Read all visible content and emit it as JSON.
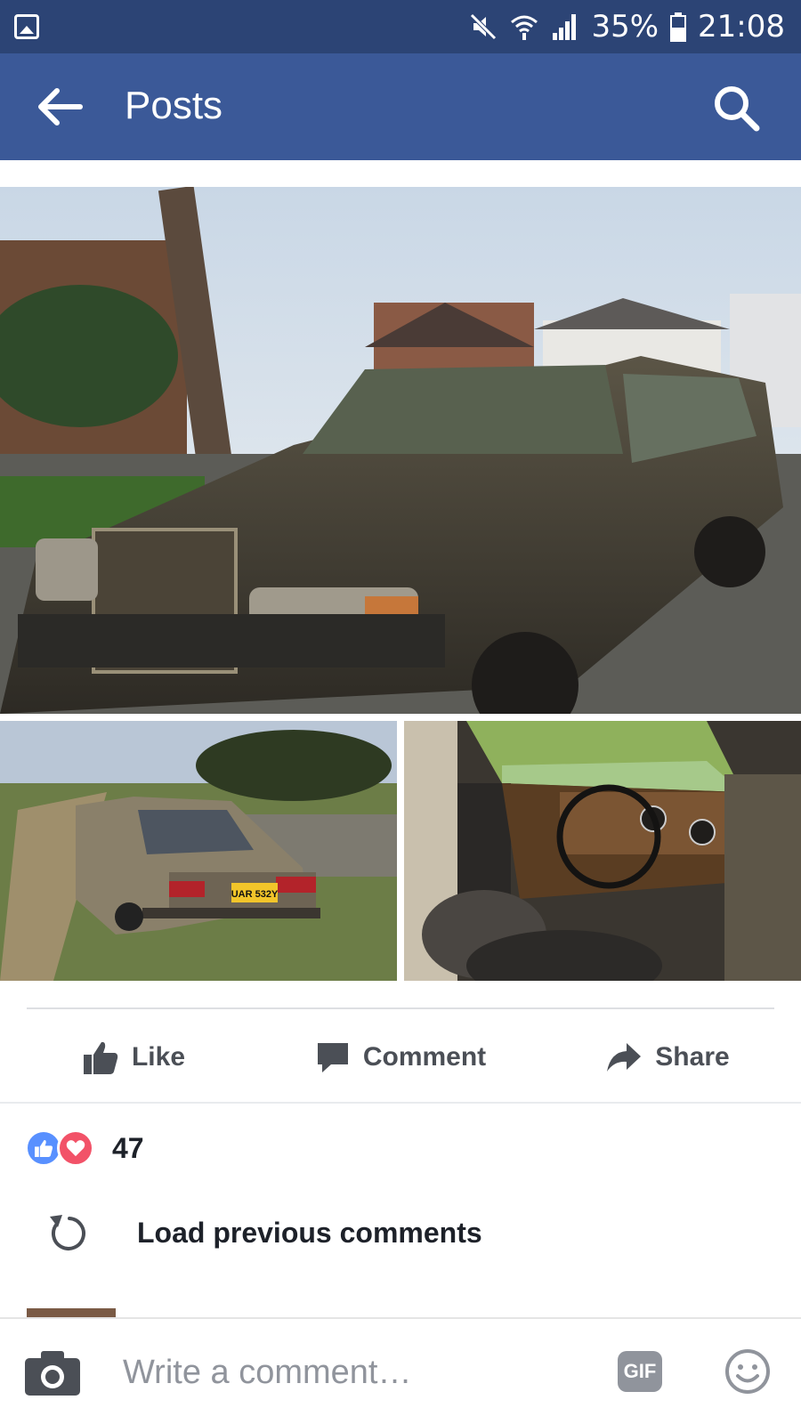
{
  "status_bar": {
    "battery": "35%",
    "time": "21:08"
  },
  "app_bar": {
    "title": "Posts"
  },
  "post": {
    "photos": [
      {
        "alt": "Rolls-Royce sedan parked on a residential street"
      },
      {
        "alt": "Rear view of the car on a countryside track",
        "plate": "UAR 532Y"
      },
      {
        "alt": "Interior with wooden dashboard and steering wheel"
      }
    ],
    "actions": {
      "like": "Like",
      "comment": "Comment",
      "share": "Share"
    },
    "reactions": {
      "count": "47"
    },
    "comments": {
      "load_previous": "Load previous comments"
    }
  },
  "composer": {
    "placeholder": "Write a comment…",
    "gif_label": "GIF"
  },
  "colors": {
    "status_bar": "#2c4475",
    "app_bar": "#3b5998",
    "like_reaction": "#5890ff",
    "love_reaction": "#f25268",
    "action_text": "#4b4f56",
    "placeholder": "#90949c"
  }
}
